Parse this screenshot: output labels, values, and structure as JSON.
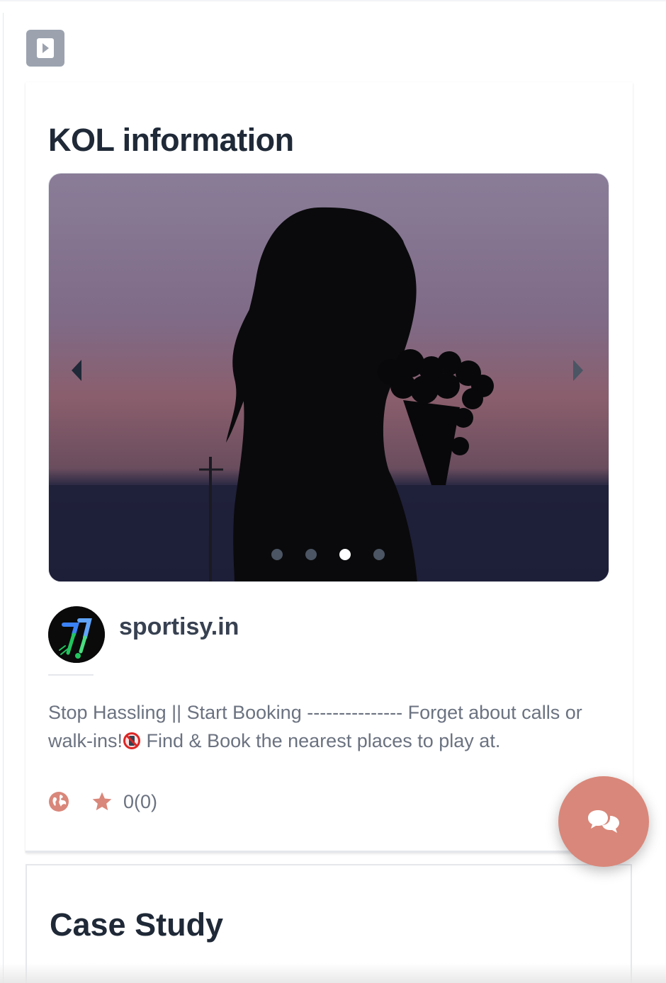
{
  "sidebar": {
    "toggle_icon": "play-icon"
  },
  "kol_card": {
    "title": "KOL information",
    "carousel": {
      "image": "silhouette-woman-with-flowers-at-dusk",
      "prev_icon": "chevron-left-icon",
      "next_icon": "chevron-right-icon",
      "slide_count": 4,
      "active_index": 2
    },
    "profile": {
      "avatar_icon": "sportisy-logo",
      "name": "sportisy.in"
    },
    "bio": {
      "text_before": "Stop Hassling || Start Booking --------------- Forget about calls or walk-ins!",
      "emoji": "no-mobile-phones-icon",
      "text_after": " Find & Book the nearest places to play at."
    },
    "meta": {
      "globe_icon": "globe-icon",
      "star_icon": "star-icon",
      "rating": "0(0)"
    }
  },
  "case_study": {
    "title": "Case Study"
  },
  "chat_button": {
    "icon": "chat-bubbles-icon"
  },
  "colors": {
    "accent": "#d9877a",
    "title": "#1f2937",
    "muted": "#6b7280",
    "toggle_bg": "#9ca3af"
  }
}
